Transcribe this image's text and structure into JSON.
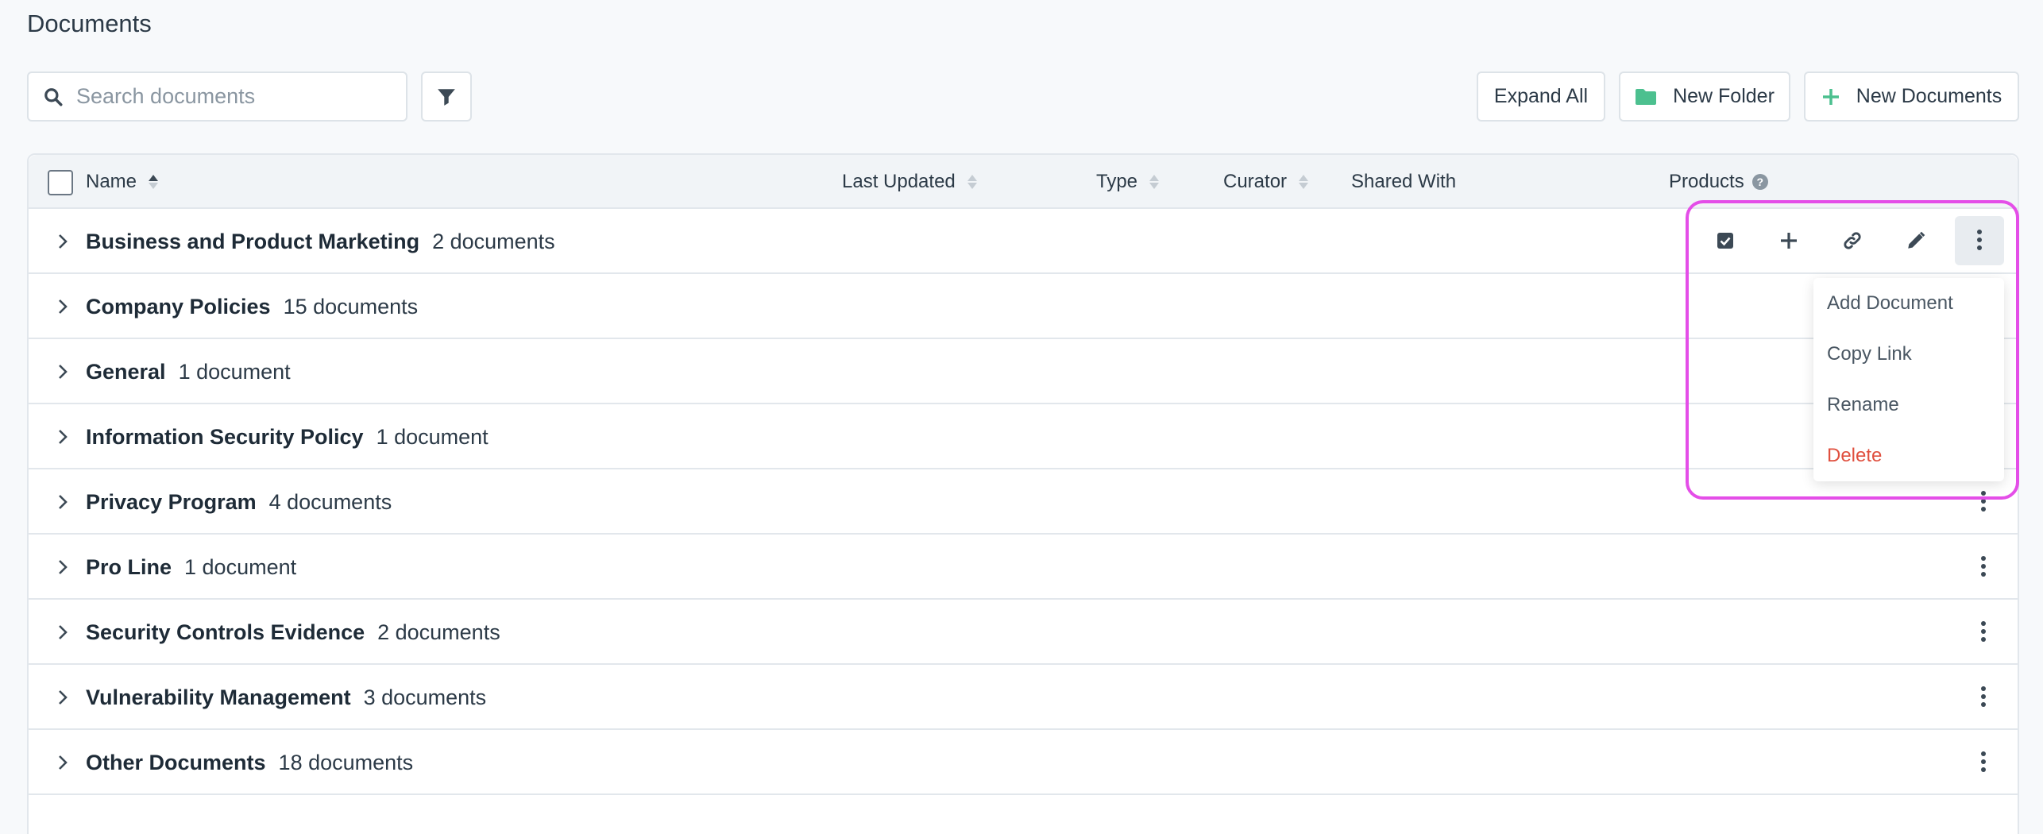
{
  "page": {
    "title": "Documents"
  },
  "search": {
    "placeholder": "Search documents",
    "value": ""
  },
  "toolbar": {
    "expand_all": "Expand All",
    "new_folder": "New Folder",
    "new_documents": "New Documents"
  },
  "table": {
    "columns": {
      "name": "Name",
      "last_updated": "Last Updated",
      "type": "Type",
      "curator": "Curator",
      "shared_with": "Shared With",
      "products": "Products"
    },
    "rows": [
      {
        "name": "Business and Product Marketing",
        "count": "2 documents"
      },
      {
        "name": "Company Policies",
        "count": "15 documents"
      },
      {
        "name": "General",
        "count": "1 document"
      },
      {
        "name": "Information Security Policy",
        "count": "1 document"
      },
      {
        "name": "Privacy Program",
        "count": "4 documents"
      },
      {
        "name": "Pro Line",
        "count": "1 document"
      },
      {
        "name": "Security Controls Evidence",
        "count": "2 documents"
      },
      {
        "name": "Vulnerability Management",
        "count": "3 documents"
      },
      {
        "name": "Other Documents",
        "count": "18 documents"
      }
    ]
  },
  "row_actions": {
    "icons": [
      "checkbox-icon",
      "plus-icon",
      "link-icon",
      "pencil-icon",
      "kebab-menu-icon"
    ]
  },
  "menu": {
    "items": [
      {
        "label": "Add Document"
      },
      {
        "label": "Copy Link"
      },
      {
        "label": "Rename"
      },
      {
        "label": "Delete",
        "color": "#e0503f"
      }
    ]
  },
  "colors": {
    "accent_green": "#4cc08f",
    "highlight": "#e44ee8",
    "delete": "#e0503f"
  }
}
